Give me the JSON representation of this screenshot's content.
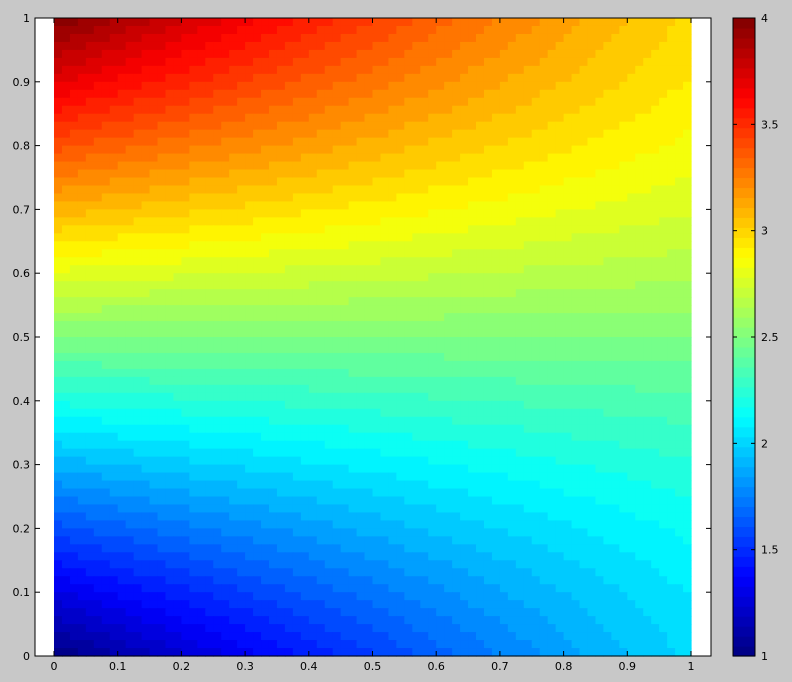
{
  "figure": {
    "background": "#c8c8c8",
    "axes_background": "#ffffff"
  },
  "chart_data": {
    "type": "heatmap",
    "subtype": "filled-contour",
    "title": "",
    "xlabel": "",
    "ylabel": "",
    "xlim": [
      0,
      1
    ],
    "ylim": [
      0,
      1
    ],
    "x_ticks": [
      0,
      0.1,
      0.2,
      0.3,
      0.4,
      0.5,
      0.6,
      0.7,
      0.8,
      0.9,
      1
    ],
    "x_tick_labels": [
      "0",
      "0.1",
      "0.2",
      "0.3",
      "0.4",
      "0.5",
      "0.6",
      "0.7",
      "0.8",
      "0.9",
      "1"
    ],
    "y_ticks": [
      0,
      0.1,
      0.2,
      0.3,
      0.4,
      0.5,
      0.6,
      0.7,
      0.8,
      0.9,
      1
    ],
    "y_tick_labels": [
      "0",
      "0.1",
      "0.2",
      "0.3",
      "0.4",
      "0.5",
      "0.6",
      "0.7",
      "0.8",
      "0.9",
      "1"
    ],
    "colormap": "jet",
    "colorbar": {
      "range": [
        1,
        4
      ],
      "ticks": [
        1,
        1.5,
        2,
        2.5,
        3,
        3.5,
        4
      ],
      "tick_labels": [
        "1",
        "1.5",
        "2",
        "2.5",
        "3",
        "3.5",
        "4"
      ],
      "placement": "right"
    },
    "field": {
      "description_points": [
        {
          "x": 0,
          "y": 0,
          "value": 1.0
        },
        {
          "x": 1,
          "y": 0,
          "value": 2.0
        },
        {
          "x": 0,
          "y": 1,
          "value": 4.0
        },
        {
          "x": 1,
          "y": 1,
          "value": 3.0
        },
        {
          "x": 0,
          "y": 0.5,
          "value": 2.5
        },
        {
          "x": 1,
          "y": 0.5,
          "value": 2.5
        }
      ]
    },
    "grid": false
  }
}
